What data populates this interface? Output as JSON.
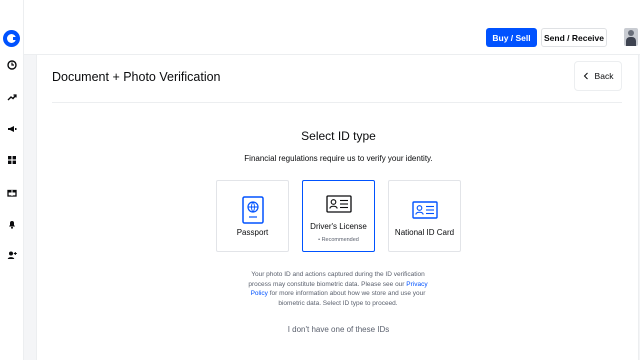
{
  "colors": {
    "accent": "#0052ff",
    "text": "#0a0b0d",
    "muted": "#5b616e",
    "border": "#e2e4e8"
  },
  "sidebar": {
    "logo_icon": "coinbase-logo",
    "items": [
      {
        "icon": "clock-icon"
      },
      {
        "icon": "trending-icon"
      },
      {
        "icon": "megaphone-icon"
      },
      {
        "icon": "grid-icon"
      },
      {
        "icon": "gift-icon"
      },
      {
        "icon": "bell-icon"
      },
      {
        "icon": "user-plus-icon"
      }
    ]
  },
  "header": {
    "buy_sell_label": "Buy / Sell",
    "send_receive_label": "Send / Receive"
  },
  "page": {
    "title": "Document + Photo Verification",
    "back_label": "Back",
    "heading": "Select ID type",
    "subtitle": "Financial regulations require us to verify your identity.",
    "options": [
      {
        "label": "Passport",
        "sublabel": "",
        "selected": false,
        "icon": "passport-icon"
      },
      {
        "label": "Driver's License",
        "sublabel": "• Recommended",
        "selected": true,
        "icon": "id-card-icon"
      },
      {
        "label": "National ID Card",
        "sublabel": "",
        "selected": false,
        "icon": "id-card-icon"
      }
    ],
    "disclaimer_part1": "Your photo ID and actions captured during the ID verification process may constitute biometric data. Please see our ",
    "disclaimer_link": "Privacy Policy",
    "disclaimer_part2": " for more information about how we store and use your biometric data. Select ID type to proceed.",
    "no_ids_label": "I don't have one of these IDs"
  }
}
